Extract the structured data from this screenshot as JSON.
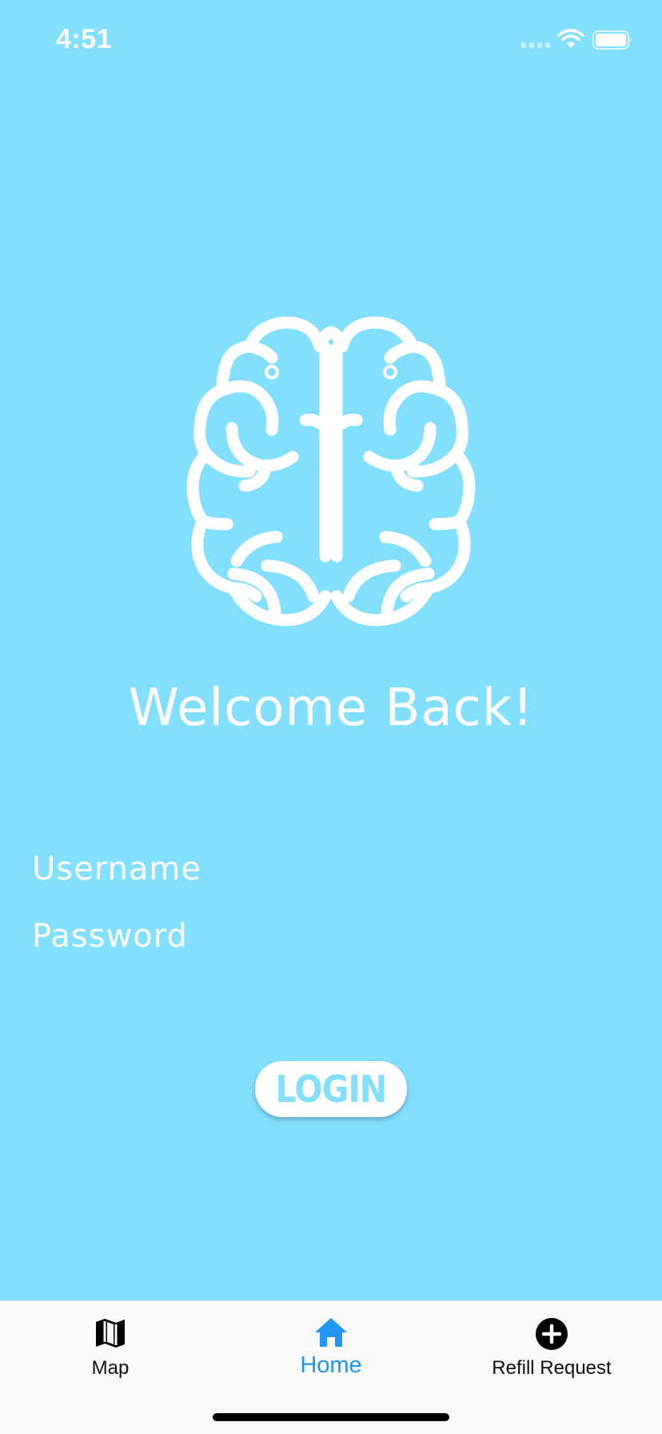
{
  "status_bar": {
    "time": "4:51",
    "icons": [
      "signal-icon",
      "wifi-icon",
      "battery-icon"
    ]
  },
  "logo": {
    "icon": "brain-icon"
  },
  "welcome": {
    "title": "Welcome Back!"
  },
  "form": {
    "username_placeholder": "Username",
    "username_value": "",
    "password_placeholder": "Password",
    "password_value": ""
  },
  "login_button": {
    "label": "LOGIN"
  },
  "tab_bar": {
    "tabs": [
      {
        "label": "Map",
        "icon": "map-icon",
        "selected": false
      },
      {
        "label": "Home",
        "icon": "home-icon",
        "selected": true
      },
      {
        "label": "Refill Request",
        "icon": "add-circle-icon",
        "selected": false
      }
    ]
  },
  "colors": {
    "background": "#83dffe",
    "foreground": "#ffffff",
    "tab_active": "#2196f3",
    "tab_inactive": "#111111",
    "tab_bar_bg": "#f9f9f9"
  }
}
